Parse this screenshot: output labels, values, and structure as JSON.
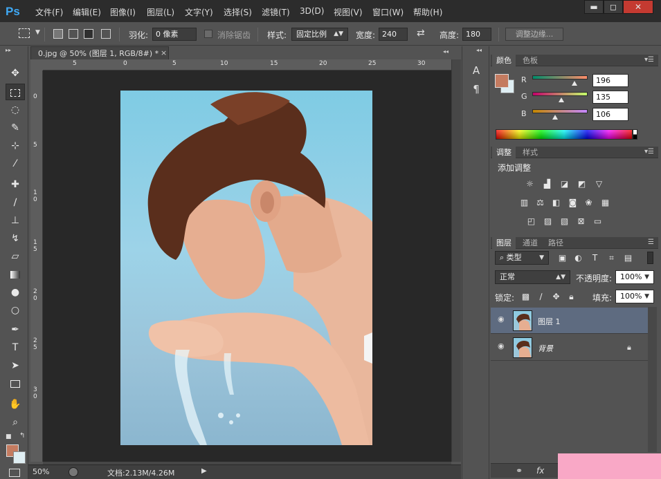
{
  "app": {
    "logo": "Ps"
  },
  "menu": [
    "文件(F)",
    "编辑(E)",
    "图像(I)",
    "图层(L)",
    "文字(Y)",
    "选择(S)",
    "滤镜(T)",
    "3D(D)",
    "视图(V)",
    "窗口(W)",
    "帮助(H)"
  ],
  "window_controls": {
    "minimize": "▬",
    "restore": "◻",
    "close": "✕"
  },
  "options": {
    "feather_label": "羽化:",
    "feather_value": "0 像素",
    "antialias_label": "消除锯齿",
    "style_label": "样式:",
    "style_value": "固定比例",
    "width_label": "宽度:",
    "width_value": "240",
    "height_label": "高度:",
    "height_value": "180",
    "refine_edge": "调整边缘..."
  },
  "document": {
    "tab_title": "0.jpg @ 50% (图层 1, RGB/8#) *",
    "tab_close": "×",
    "ruler_top": [
      "5",
      "0",
      "5",
      "10",
      "15",
      "20",
      "25",
      "30"
    ],
    "ruler_left": [
      "0",
      "5",
      "1 0",
      "1 5",
      "2 0",
      "2 5",
      "3 0"
    ]
  },
  "status": {
    "zoom": "50%",
    "doc_info": "文档:2.13M/4.26M"
  },
  "mini_panel": {
    "char_icon": "A",
    "para_icon": "¶"
  },
  "color_panel": {
    "tabs": [
      "颜色",
      "色板"
    ],
    "r_label": "R",
    "g_label": "G",
    "b_label": "B",
    "r_value": "196",
    "g_value": "135",
    "b_value": "106",
    "r": 196,
    "g": 135,
    "b": 106,
    "foreground": "#c47b60",
    "background": "#dfeef3"
  },
  "adjust_panel": {
    "tabs": [
      "调整",
      "样式"
    ],
    "title": "添加调整"
  },
  "layers_panel": {
    "tabs": [
      "图层",
      "通道",
      "路径"
    ],
    "filter_label": "类型",
    "blend_mode": "正常",
    "opacity_label": "不透明度:",
    "opacity_value": "100%",
    "lock_label": "锁定:",
    "fill_label": "填充:",
    "fill_value": "100%",
    "layers": [
      {
        "name": "图层 1",
        "selected": true
      },
      {
        "name": "背景",
        "selected": false
      }
    ]
  },
  "colors": {
    "accent": "#3fa9f5",
    "selected_layer": "#5e6b80",
    "close_button": "#c43a31"
  }
}
